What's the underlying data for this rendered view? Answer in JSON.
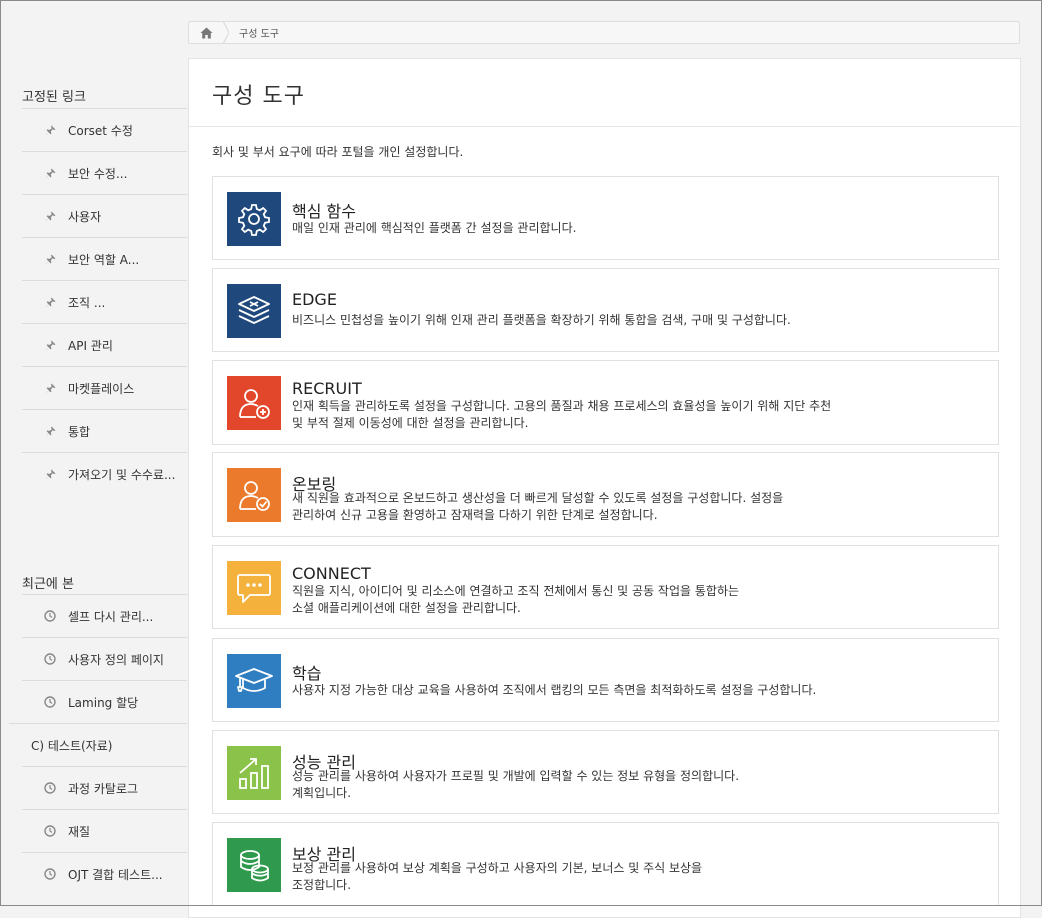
{
  "breadcrumb": {
    "current": "구성 도구"
  },
  "pinned": {
    "title": "고정된 링크",
    "items": [
      "Corset 수정",
      "보안 수정...",
      "사용자",
      "보안 역할 A...",
      "조직 ...",
      "API 관리",
      "마켓플레이스",
      "통합",
      "가져오기 및 수수료..."
    ]
  },
  "recent": {
    "title": "최근에 본",
    "items": [
      "셀프 다시 관리...",
      "사용자 정의 페이지",
      "Laming 할당",
      "C) 테스트(자료)",
      "과정 카탈로그",
      "재질",
      "OJT 결합 테스트..."
    ]
  },
  "main": {
    "title": "구성 도구",
    "description": "회사 및 부서 요구에 따라 포털을 개인 설정합니다.",
    "cards": [
      {
        "title": "핵심 함수",
        "lines": [
          "매일 인재 관리에 핵심적인 플랫폼 간 설정을 관리합니다."
        ],
        "icon": "gear-icon",
        "color": "#1f497d"
      },
      {
        "title": "EDGE",
        "lines": [
          "비즈니스 민첩성을 높이기 위해 인재 관리 플랫폼을 확장하기 위해 통합을 검색, 구매 및 구성합니다."
        ],
        "icon": "layers-icon",
        "color": "#1f497d"
      },
      {
        "title": "RECRUIT",
        "lines": [
          "인재 획득을 관리하도록 설정을 구성합니다. 고용의 품질과 채용 프로세스의 효율성을 높이기 위해 지단 추천",
          "및 부적 절제 이동성에 대한 설정을 관리합니다."
        ],
        "icon": "user-add-icon",
        "color": "#e2462b"
      },
      {
        "title": "온보링",
        "lines": [
          "새 직원을 효과적으로 온보드하고 생산성을 더 빠르게 달성할 수 있도록 설정을 구성합니다. 설정을",
          "관리하여 신규 고용을 환영하고 잠재력을 다하기 위한 단계로 설정합니다."
        ],
        "icon": "user-check-icon",
        "color": "#ec7a2c"
      },
      {
        "title": "CONNECT",
        "lines": [
          "직원을 지식, 아이디어 및 리소스에 연결하고 조직 전체에서 통신 및 공동 작업을 통합하는",
          "소셜 애플리케이션에 대한 설정을 관리합니다."
        ],
        "icon": "chat-icon",
        "color": "#f4b13c"
      },
      {
        "title": "학습",
        "lines": [
          "사용자 지정 가능한 대상 교육을 사용하여 조직에서 랩킹의 모든 측면을 최적화하도록 설정을 구성합니다."
        ],
        "icon": "graduation-cap-icon",
        "color": "#2f7ec1"
      },
      {
        "title": "성능 관리",
        "lines": [
          "성능 관리를 사용하여 사용자가 프로필 및 개발에 입력할 수 있는 정보 유형을 정의합니다.",
          "계획입니다."
        ],
        "icon": "growth-chart-icon",
        "color": "#8bc34a"
      },
      {
        "title": "보상 관리",
        "lines": [
          "보정 관리를 사용하여 보상 계획을 구성하고 사용자의 기본, 보너스 및 주식 보상을",
          "조정합니다."
        ],
        "icon": "coins-icon",
        "color": "#2f9a4d"
      }
    ]
  }
}
